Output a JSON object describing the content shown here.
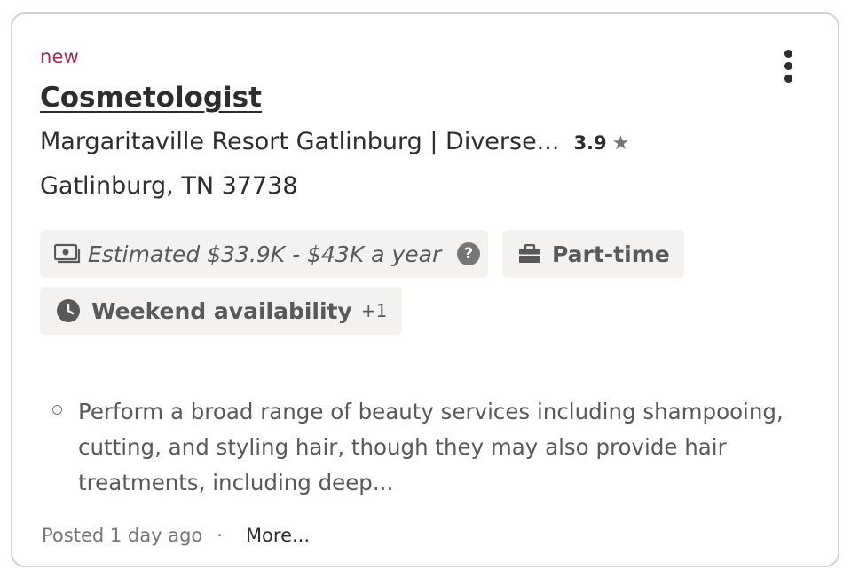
{
  "job": {
    "badge": "new",
    "title": "Cosmetologist",
    "company": "Margaritaville Resort Gatlinburg | Diverse...",
    "rating": "3.9",
    "location": "Gatlinburg, TN 37738",
    "salary": "Estimated $33.9K - $43K a year",
    "salary_help": "?",
    "job_type": "Part-time",
    "shift": "Weekend availability",
    "shift_more": "+1",
    "snippet": "Perform a broad range of beauty services including shampooing, cutting, and styling hair, though they may also provide hair treatments, including deep...",
    "posted": "Posted 1 day ago",
    "separator": "·",
    "more_link": "More..."
  },
  "icons": {
    "menu": "kebab-menu-icon",
    "star": "star-icon",
    "salary": "money-icon",
    "help": "help-circle-icon",
    "job_type": "briefcase-icon",
    "shift": "clock-icon",
    "bullet": "circle-bullet-icon"
  },
  "colors": {
    "badge": "#9b2a5a",
    "text_primary": "#2d2d2d",
    "text_secondary": "#595959",
    "chip_background": "#f3f2f1",
    "border": "#d4d2d0"
  }
}
